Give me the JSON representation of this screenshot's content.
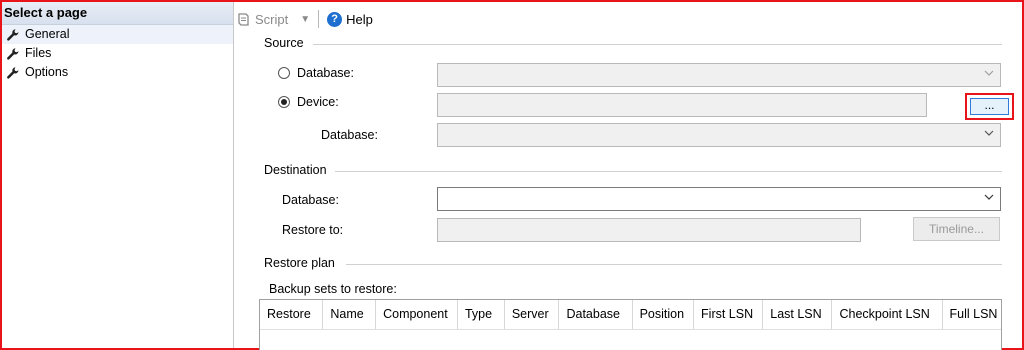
{
  "sidebar": {
    "header": "Select a page",
    "items": [
      {
        "label": "General",
        "icon": "wrench-icon"
      },
      {
        "label": "Files",
        "icon": "wrench-icon"
      },
      {
        "label": "Options",
        "icon": "wrench-icon"
      }
    ]
  },
  "toolbar": {
    "script_label": "Script",
    "help_label": "Help"
  },
  "source": {
    "title": "Source",
    "database_radio_label": "Database:",
    "device_radio_label": "Device:",
    "device_database_label": "Database:",
    "device_value": "",
    "browse_label": "...",
    "selected": "device"
  },
  "destination": {
    "title": "Destination",
    "database_label": "Database:",
    "database_value": "",
    "restore_to_label": "Restore to:",
    "restore_to_value": "",
    "timeline_label": "Timeline..."
  },
  "restore_plan": {
    "title": "Restore plan",
    "backup_sets_label": "Backup sets to restore:",
    "columns": [
      "Restore",
      "Name",
      "Component",
      "Type",
      "Server",
      "Database",
      "Position",
      "First LSN",
      "Last LSN",
      "Checkpoint LSN",
      "Full LSN"
    ]
  },
  "colors": {
    "highlight_border": "#e8141a",
    "accent": "#1e6fd0"
  }
}
